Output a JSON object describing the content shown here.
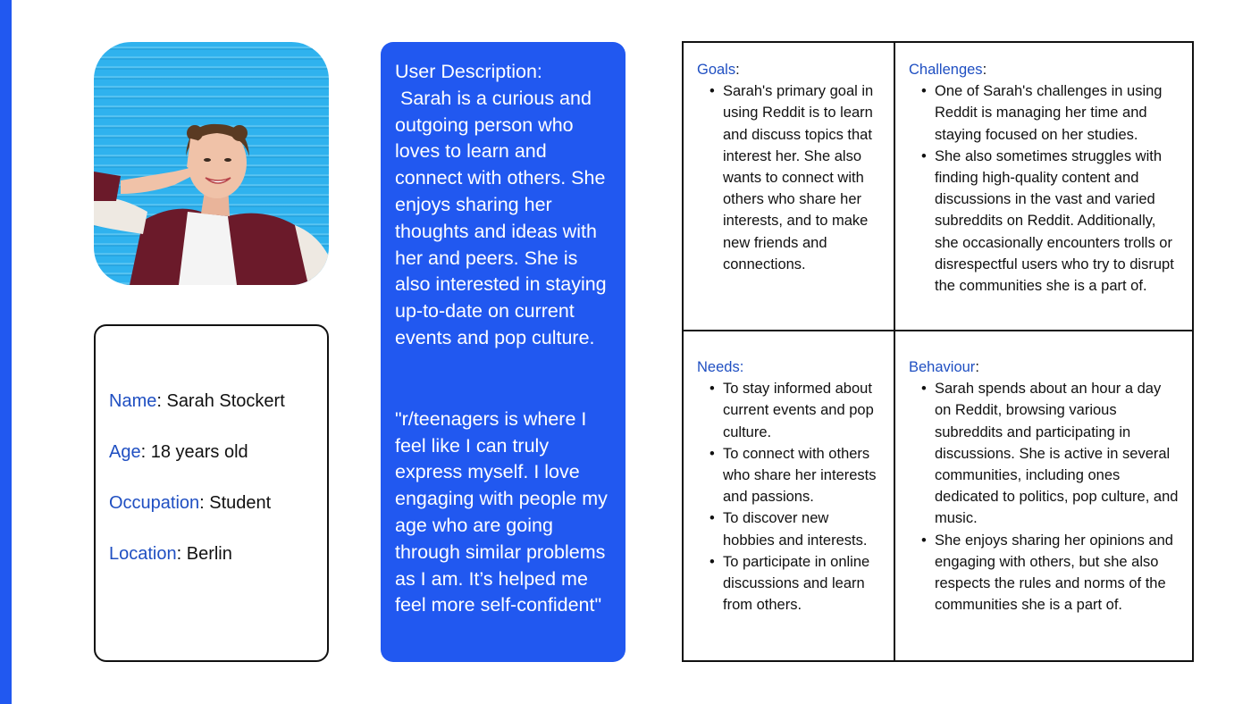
{
  "accent_color": "#2158f0",
  "label_color": "#1f4fc2",
  "photo": {
    "alt": "Smiling teenage girl making a peace sign in front of a blue corrugated wall"
  },
  "profile": {
    "name": {
      "label": "Name",
      "value": ": Sarah Stockert"
    },
    "age": {
      "label": "Age",
      "value": ": 18 years old"
    },
    "occupation": {
      "label": "Occupation",
      "value": ": Student"
    },
    "location": {
      "label": "Location",
      "value": ": Berlin"
    }
  },
  "description": {
    "text": "User Description:\n Sarah is a curious and outgoing person who loves to learn and connect with others. She enjoys sharing her thoughts and ideas with her and peers. She is also interested in staying up-to-date on current events and pop culture.",
    "quote": "\"r/teenagers is where I feel like I can truly express myself. I love engaging with people my age who are going through similar problems as I am. It’s helped me feel more self-confident\""
  },
  "goals": {
    "title": "Goals",
    "colon": ":",
    "items": [
      "Sarah's primary goal in using Reddit is to learn and discuss topics that interest her. She also wants to connect with others who share her interests, and to make new friends and connections."
    ]
  },
  "challenges": {
    "title": "Challenges",
    "colon": ":",
    "items": [
      "One of Sarah's challenges in using Reddit is managing her time and staying focused on her studies.",
      "She also sometimes struggles with finding high-quality content and discussions in the vast and varied subreddits on Reddit. Additionally, she occasionally encounters trolls or disrespectful users who try to disrupt the communities she is a part of."
    ]
  },
  "needs": {
    "title": "Needs:",
    "colon": "",
    "items": [
      "To stay informed about current events and pop culture.",
      "To connect with others who share her interests and passions.",
      "To discover new hobbies and interests.",
      "To participate in online discussions and learn from others."
    ]
  },
  "behaviour": {
    "title": "Behaviour",
    "colon": ":",
    "items": [
      " Sarah spends about an hour a day on Reddit, browsing various subreddits and participating in discussions. She is active in several communities, including ones dedicated to politics, pop culture, and music.",
      "She enjoys sharing her opinions and engaging with others, but she also respects the rules and norms of the communities she is a part of."
    ]
  }
}
